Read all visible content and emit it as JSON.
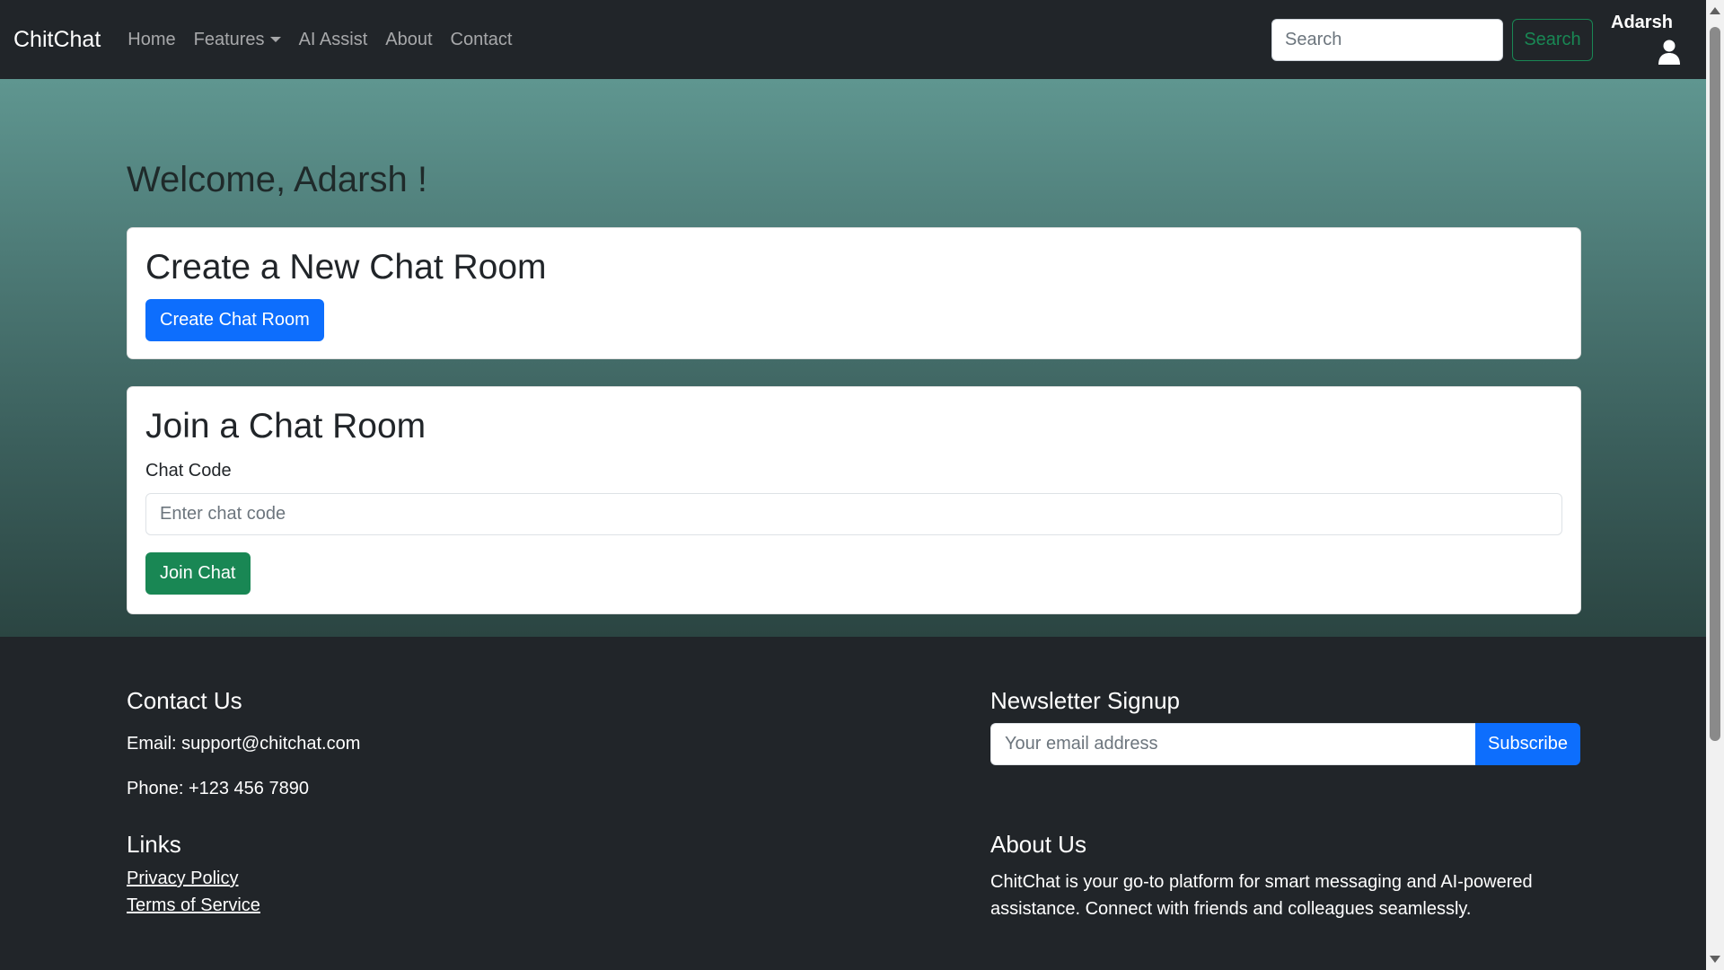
{
  "navbar": {
    "brand": "ChitChat",
    "links": [
      {
        "label": "Home"
      },
      {
        "label": "Features",
        "dropdown": true
      },
      {
        "label": "AI Assist"
      },
      {
        "label": "About"
      },
      {
        "label": "Contact"
      }
    ],
    "search_placeholder": "Search",
    "search_button": "Search",
    "user_name": "Adarsh",
    "user_icon": "user-icon"
  },
  "main": {
    "welcome": "Welcome, Adarsh !",
    "create_card": {
      "title": "Create a New Chat Room",
      "button": "Create Chat Room"
    },
    "join_card": {
      "title": "Join a Chat Room",
      "code_label": "Chat Code",
      "code_placeholder": "Enter chat code",
      "button": "Join Chat"
    }
  },
  "footer": {
    "contact": {
      "heading": "Contact Us",
      "email": "Email: support@chitchat.com",
      "phone": "Phone: +123 456 7890"
    },
    "newsletter": {
      "heading": "Newsletter Signup",
      "placeholder": "Your email address",
      "button": "Subscribe"
    },
    "links": {
      "heading": "Links",
      "items": [
        "Privacy Policy",
        "Terms of Service"
      ]
    },
    "about": {
      "heading": "About Us",
      "text": "ChitChat is your go-to platform for smart messaging and AI-powered assistance. Connect with friends and colleagues seamlessly."
    }
  },
  "colors": {
    "primary": "#0d6efd",
    "success": "#198754",
    "navbar_bg": "#212529",
    "hero_top": "#5f9690",
    "hero_bottom": "#2b4542"
  }
}
